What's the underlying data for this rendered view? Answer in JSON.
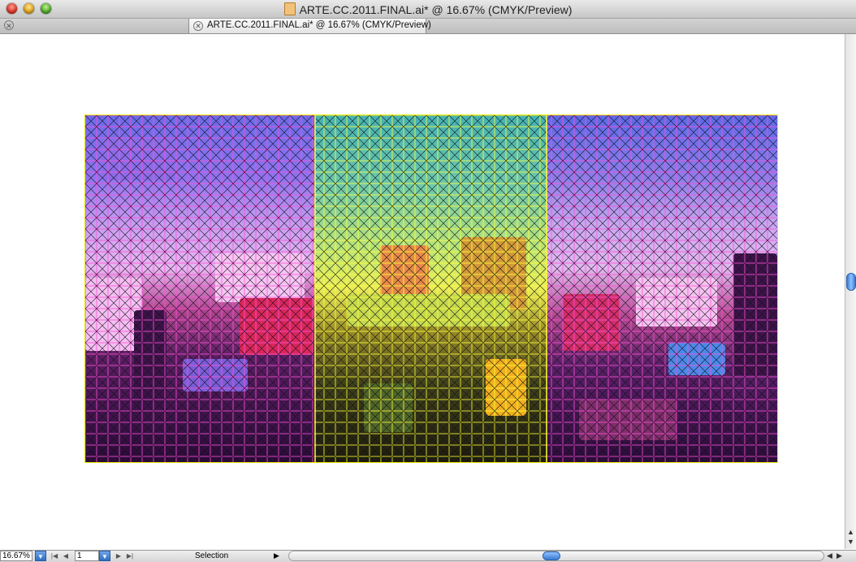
{
  "window": {
    "title": "ARTE.CC.2011.FINAL.ai* @ 16.67% (CMYK/Preview)"
  },
  "tabs": [
    {
      "label": "ARTE.CC.2011.FINAL.ai* @ 16.67% (CMYK/Preview)",
      "active": true
    }
  ],
  "statusbar": {
    "zoom_value": "16.67%",
    "page_value": "1",
    "status_text": "Selection"
  },
  "icons": {
    "close": "close-icon",
    "minimize": "minimize-icon",
    "zoom": "zoom-icon",
    "document": "document-icon",
    "dropdown": "chevron-down-icon"
  },
  "colors": {
    "selection_grid": "#ff4fd8",
    "selection_grid_center": "#ffff33",
    "scroll_thumb": "#3a7bd5"
  }
}
